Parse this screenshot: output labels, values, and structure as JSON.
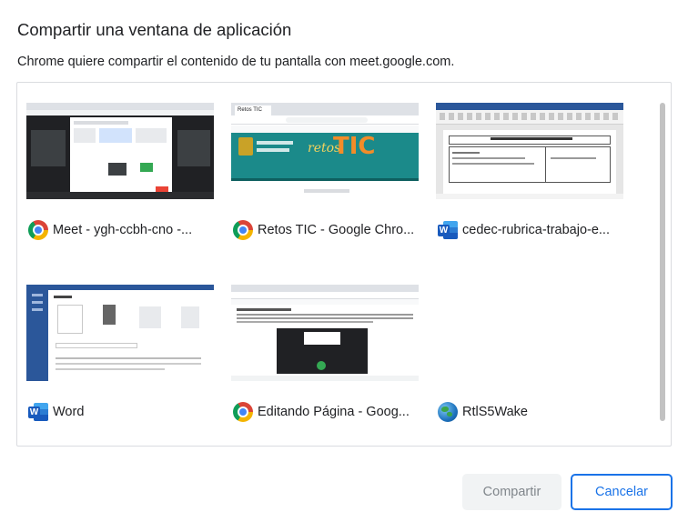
{
  "dialog": {
    "title": "Compartir una ventana de aplicación",
    "subtitle": "Chrome quiere compartir el contenido de tu pantalla con meet.google.com."
  },
  "windows": [
    {
      "label": "Meet - ygh-ccbh-cno -...",
      "icon": "chrome-icon"
    },
    {
      "label": "Retos TIC - Google Chro...",
      "icon": "chrome-icon"
    },
    {
      "label": "cedec-rubrica-trabajo-e...",
      "icon": "word-icon"
    },
    {
      "label": "Word",
      "icon": "word-icon"
    },
    {
      "label": "Editando Página - Goog...",
      "icon": "chrome-icon"
    },
    {
      "label": "RtlS5Wake",
      "icon": "globe-icon"
    }
  ],
  "thumb_text": {
    "retos_tab": "Retos TIC",
    "retos_brand": "retos",
    "retos_tic": "TIC"
  },
  "buttons": {
    "share": "Compartir",
    "cancel": "Cancelar"
  },
  "colors": {
    "accent": "#1a73e8",
    "disabled_bg": "#f1f3f4",
    "disabled_text": "#80868b"
  }
}
